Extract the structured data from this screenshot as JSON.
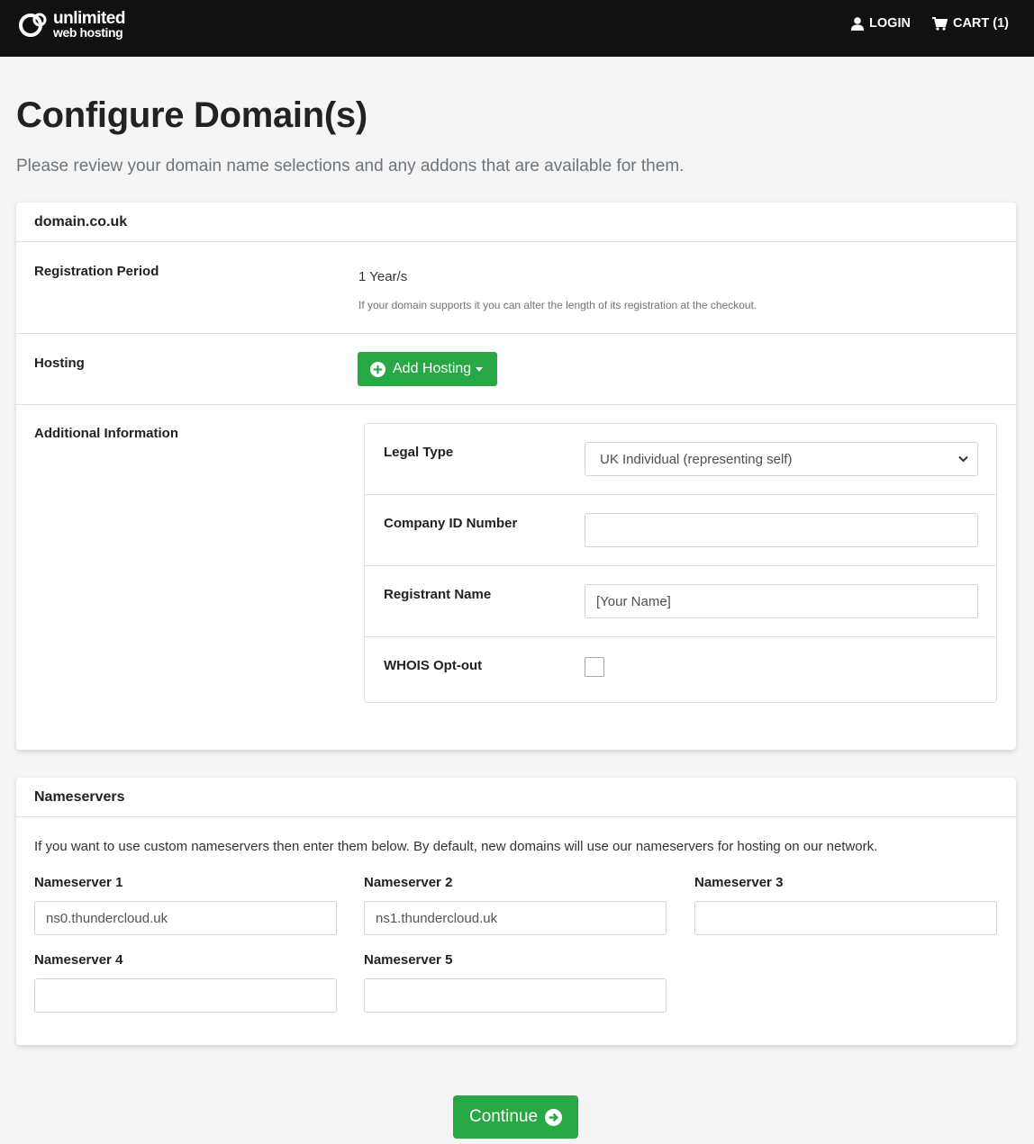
{
  "brand": {
    "line1": "unlimited",
    "line2": "web hosting"
  },
  "nav": {
    "login": "LOGIN",
    "cart": "CART (1)"
  },
  "page": {
    "title": "Configure Domain(s)",
    "subtitle": "Please review your domain name selections and any addons that are available for them."
  },
  "domain": {
    "name": "domain.co.uk",
    "registration_label": "Registration Period",
    "registration_value": "1 Year/s",
    "registration_help": "If your domain supports it you can alter the length of its registration at the checkout.",
    "hosting_label": "Hosting",
    "add_hosting": "Add Hosting",
    "additional_label": "Additional Information",
    "fields": {
      "legal_type_label": "Legal Type",
      "legal_type_value": "UK Individual (representing self)",
      "company_id_label": "Company ID Number",
      "company_id_value": "",
      "registrant_label": "Registrant Name",
      "registrant_value": "[Your Name]",
      "whois_label": "WHOIS Opt-out"
    }
  },
  "nameservers": {
    "title": "Nameservers",
    "description": "If you want to use custom nameservers then enter them below. By default, new domains will use our nameservers for hosting on our network.",
    "items": [
      {
        "label": "Nameserver 1",
        "value": "ns0.thundercloud.uk"
      },
      {
        "label": "Nameserver 2",
        "value": "ns1.thundercloud.uk"
      },
      {
        "label": "Nameserver 3",
        "value": ""
      },
      {
        "label": "Nameserver 4",
        "value": ""
      },
      {
        "label": "Nameserver 5",
        "value": ""
      }
    ]
  },
  "continue_label": "Continue",
  "colors": {
    "topbar": "#111111",
    "accent_green": "#28a745",
    "background": "#f5f5f5"
  },
  "icons": {
    "login": "user-icon",
    "cart": "cart-icon",
    "add_hosting": "plus-circle-icon",
    "continue": "arrow-circle-right-icon"
  }
}
